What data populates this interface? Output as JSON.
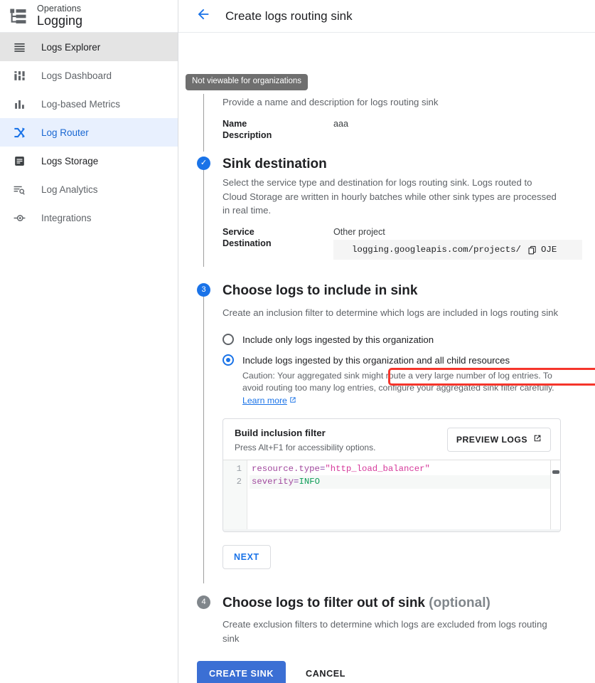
{
  "sidebar": {
    "brand": {
      "suptitle": "Operations",
      "title": "Logging",
      "icon": "operations-logo-icon"
    },
    "items": [
      {
        "label": "Logs Explorer",
        "icon": "list-icon",
        "state": "selected"
      },
      {
        "label": "Logs Dashboard",
        "icon": "dashboard-icon",
        "state": "normal"
      },
      {
        "label": "Log-based Metrics",
        "icon": "bar-chart-icon",
        "state": "normal"
      },
      {
        "label": "Log Router",
        "icon": "router-icon",
        "state": "active"
      },
      {
        "label": "Logs Storage",
        "icon": "storage-icon",
        "state": "dark"
      },
      {
        "label": "Log Analytics",
        "icon": "analytics-search-icon",
        "state": "normal"
      },
      {
        "label": "Integrations",
        "icon": "integrations-icon",
        "state": "normal"
      }
    ]
  },
  "topbar": {
    "back_icon": "arrow-left-icon",
    "title": "Create logs routing sink"
  },
  "tooltip": {
    "text": "Not viewable for organizations"
  },
  "step1": {
    "description": "Provide a name and description for logs routing sink",
    "name_label": "Name",
    "name_value": "aaa",
    "description_label": "Description",
    "description_value": ""
  },
  "step2": {
    "badge": "✓",
    "heading": "Sink destination",
    "description": "Select the service type and destination for logs routing sink. Logs routed to Cloud Storage are written in hourly batches while other sink types are processed in real time.",
    "service_label": "Service",
    "service_value": "Other project",
    "destination_label": "Destination",
    "destination_value": "logging.googleapis.com/projects/",
    "destination_tail": "OJE",
    "copy_icon": "copy-icon"
  },
  "step3": {
    "badge": "3",
    "heading": "Choose logs to include in sink",
    "description": "Create an inclusion filter to determine which logs are included in logs routing sink",
    "options": [
      {
        "label": "Include only logs ingested by this organization",
        "selected": false
      },
      {
        "label": "Include logs ingested by this organization and all child resources",
        "selected": true
      }
    ],
    "caution_line1": "Caution: Your aggregated sink might route a very large number of log entries. To",
    "caution_line2": "avoid routing too many log entries, configure your aggregated sink filter carefully.",
    "learn_more": "Learn more",
    "learn_more_icon": "external-link-icon",
    "filter": {
      "title": "Build inclusion filter",
      "subtitle": "Press Alt+F1 for accessibility options.",
      "preview_button": "PREVIEW LOGS",
      "preview_icon": "external-link-icon",
      "lines": [
        {
          "no": "1",
          "key": "resource.type",
          "op": "=",
          "str": "\"http_load_balancer\"",
          "val": ""
        },
        {
          "no": "2",
          "key": "severity",
          "op": "=",
          "str": "",
          "val": "INFO"
        }
      ]
    },
    "next_button": "NEXT"
  },
  "step4": {
    "badge": "4",
    "heading": "Choose logs to filter out of sink",
    "heading_optional": "(optional)",
    "description": "Create exclusion filters to determine which logs are excluded from logs routing sink"
  },
  "footer": {
    "create_button": "CREATE SINK",
    "cancel_button": "CANCEL"
  },
  "colors": {
    "accent": "#1a73e8",
    "primary_button": "#3b6fd4",
    "highlight": "#f5352b",
    "active_nav_bg": "#e8f0fe",
    "selected_nav_bg": "#e4e4e4"
  }
}
